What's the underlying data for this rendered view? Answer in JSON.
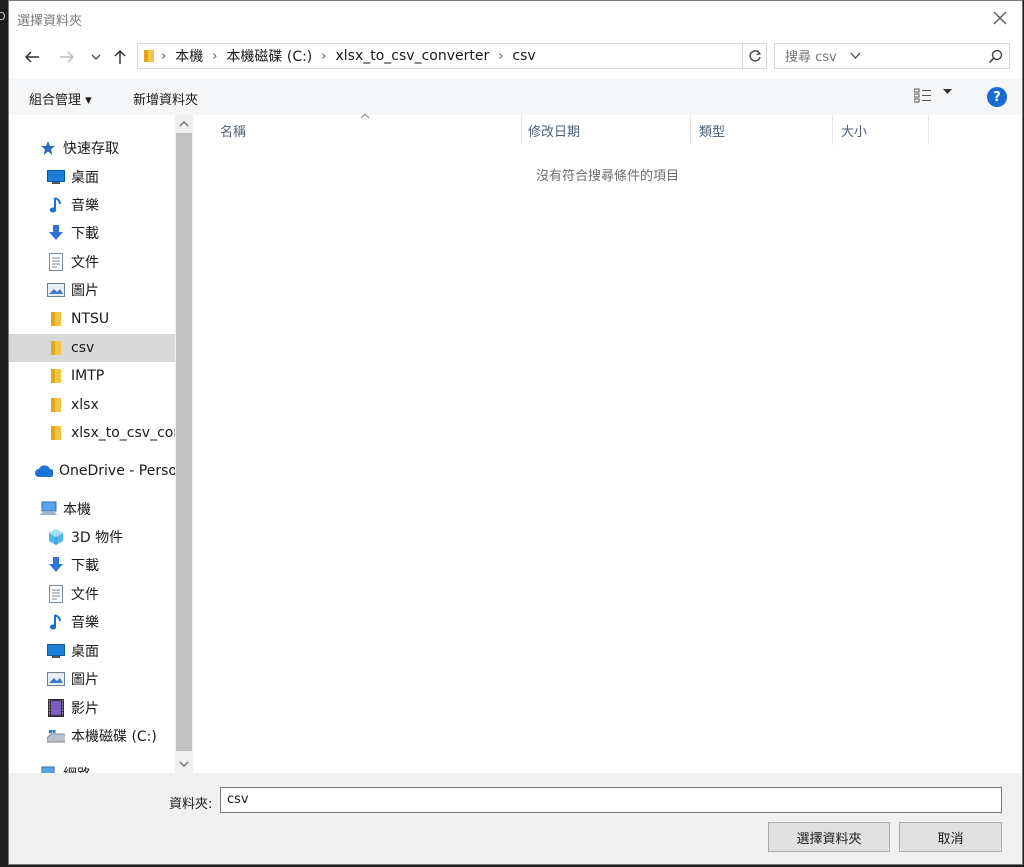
{
  "window": {
    "title": "選擇資料夾"
  },
  "address": {
    "crumbs": [
      "本機",
      "本機磁碟 (C:)",
      "xlsx_to_csv_converter",
      "csv"
    ]
  },
  "search": {
    "placeholder": "搜尋 csv"
  },
  "toolbar": {
    "organize_label": "組合管理 ▾",
    "new_folder_label": "新增資料夾",
    "help_label": "?"
  },
  "sidebar": {
    "quick_access": "快速存取",
    "quick_items": [
      {
        "label": "桌面",
        "icon": "desktop-icon",
        "pinned": true
      },
      {
        "label": "音樂",
        "icon": "music-icon",
        "pinned": true
      },
      {
        "label": "下載",
        "icon": "download-icon",
        "pinned": true
      },
      {
        "label": "文件",
        "icon": "document-icon",
        "pinned": true
      },
      {
        "label": "圖片",
        "icon": "picture-icon",
        "pinned": true
      },
      {
        "label": "NTSU",
        "icon": "folder-icon",
        "pinned": true
      },
      {
        "label": "csv",
        "icon": "folder-icon",
        "pinned": false,
        "selected": true
      },
      {
        "label": "IMTP",
        "icon": "folder-icon",
        "pinned": false
      },
      {
        "label": "xlsx",
        "icon": "folder-icon",
        "pinned": false
      },
      {
        "label": "xlsx_to_csv_conv",
        "icon": "folder-icon",
        "pinned": false
      }
    ],
    "onedrive": "OneDrive - Perso",
    "this_pc": "本機",
    "pc_items": [
      {
        "label": "3D 物件",
        "icon": "cube-3d-icon"
      },
      {
        "label": "下載",
        "icon": "download-icon"
      },
      {
        "label": "文件",
        "icon": "document-icon"
      },
      {
        "label": "音樂",
        "icon": "music-icon"
      },
      {
        "label": "桌面",
        "icon": "desktop-icon"
      },
      {
        "label": "圖片",
        "icon": "picture-icon"
      },
      {
        "label": "影片",
        "icon": "video-icon"
      },
      {
        "label": "本機磁碟 (C:)",
        "icon": "drive-icon"
      }
    ],
    "network": "網路"
  },
  "columns": [
    "名稱",
    "修改日期",
    "類型",
    "大小"
  ],
  "empty_message": "沒有符合搜尋條件的項目",
  "footer": {
    "folder_label": "資料夾:",
    "folder_value": "csv",
    "select_button": "選擇資料夾",
    "cancel_button": "取消"
  },
  "colors": {
    "selected_bg": "#d9d9d9",
    "help_blue": "#1a6bd1",
    "folder_yellow": "#f5c542"
  }
}
